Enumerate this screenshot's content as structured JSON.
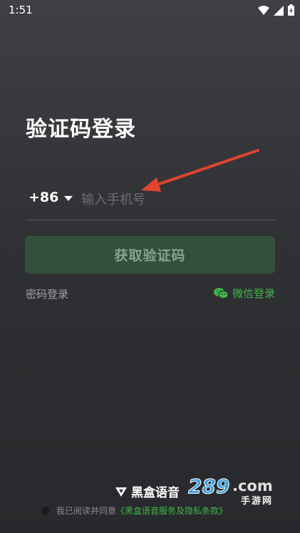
{
  "status_bar": {
    "time": "1:51"
  },
  "page": {
    "title": "验证码登录"
  },
  "phone": {
    "country_code": "+86",
    "placeholder": "输入手机号"
  },
  "actions": {
    "get_code": "获取验证码",
    "password_login": "密码登录",
    "wechat_login": "微信登录"
  },
  "brand": {
    "name": "黑盒语音"
  },
  "agreement": {
    "text": "我已阅读并同意",
    "link": "《黑盒语音服务及隐私条款》"
  },
  "watermark": {
    "number": "289",
    "suffix": ".com",
    "sub": "手游网"
  },
  "colors": {
    "accent_green": "#3fb649",
    "button_bg": "#34503c",
    "annotation_red": "#e0442e"
  },
  "icons": [
    "wifi-icon",
    "signal-icon",
    "battery-icon",
    "caret-down-icon",
    "wechat-icon",
    "brand-logo-icon"
  ]
}
